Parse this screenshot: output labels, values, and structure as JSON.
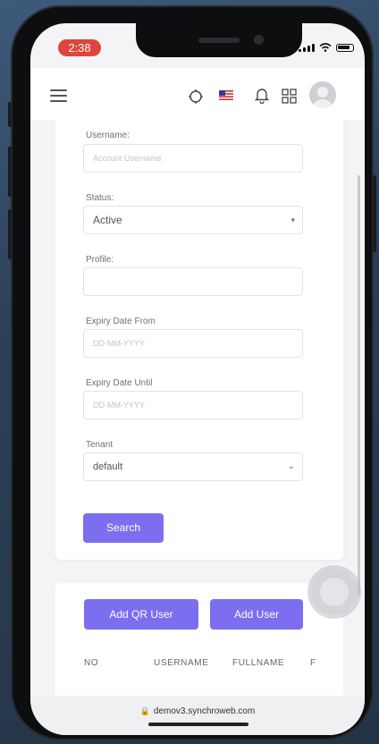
{
  "status_bar": {
    "time": "2:38"
  },
  "header": {
    "menu_icon": "hamburger-icon",
    "icons": [
      "theme-toggle-icon",
      "us-flag-icon",
      "bell-icon",
      "apps-grid-icon",
      "avatar"
    ]
  },
  "form": {
    "username": {
      "label": "Username:",
      "placeholder": "Account Username"
    },
    "status": {
      "label": "Status:",
      "value": "Active"
    },
    "profile": {
      "label": "Profile:",
      "value": ""
    },
    "expiry_from": {
      "label": "Expiry Date From",
      "placeholder": "DD-MM-YYYY"
    },
    "expiry_until": {
      "label": "Expiry Date Until",
      "placeholder": "DD-MM-YYYY"
    },
    "tenant": {
      "label": "Tenant",
      "value": "default"
    },
    "search_button": "Search"
  },
  "actions": {
    "add_qr_user": "Add QR User",
    "add_user": "Add User"
  },
  "table": {
    "columns": [
      "NO",
      "USERNAME",
      "FULLNAME",
      "F"
    ]
  },
  "browser": {
    "url": "demov3.synchroweb.com"
  },
  "colors": {
    "accent": "#7b6ff0",
    "time_pill": "#e0453b"
  }
}
